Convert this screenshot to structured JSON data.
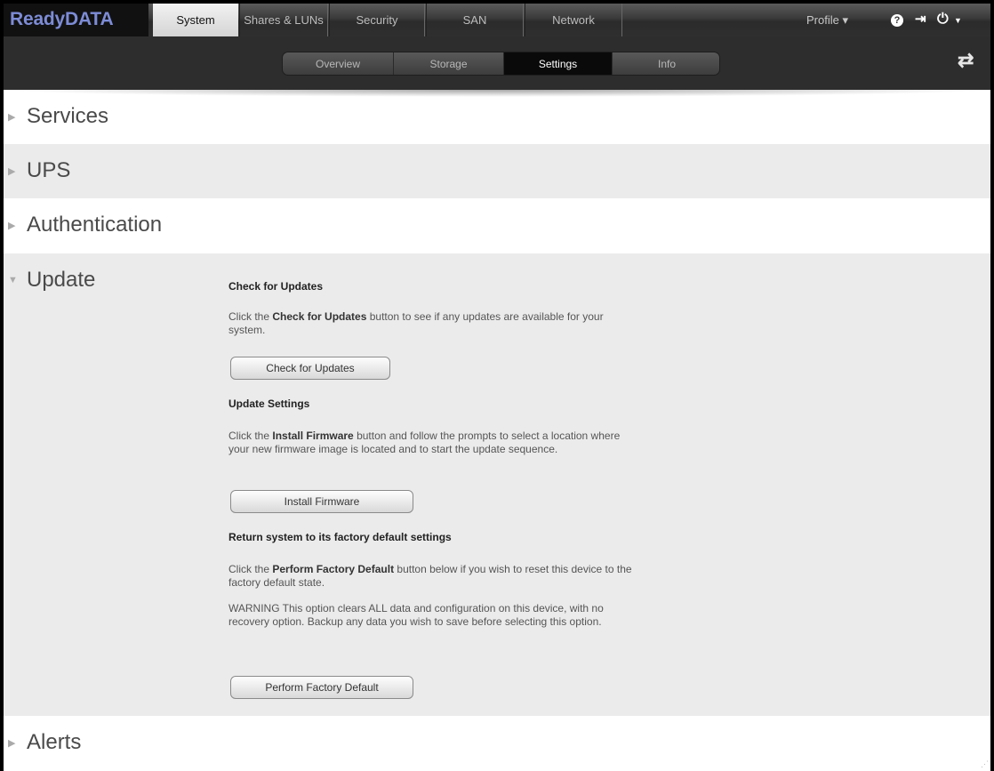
{
  "brand": "ReadyDATA",
  "top_tabs": [
    {
      "label": "System",
      "active": true
    },
    {
      "label": "Shares & LUNs",
      "active": false
    },
    {
      "label": "Security",
      "active": false
    },
    {
      "label": "SAN",
      "active": false
    },
    {
      "label": "Network",
      "active": false
    }
  ],
  "top_right": {
    "profile_label": "Profile ▾",
    "help_icon": "help-icon",
    "logout_icon": "logout-icon",
    "power_icon": "power-icon"
  },
  "sub_tabs": [
    {
      "label": "Overview",
      "active": false
    },
    {
      "label": "Storage",
      "active": false
    },
    {
      "label": "Settings",
      "active": true
    },
    {
      "label": "Info",
      "active": false
    }
  ],
  "refresh_icon": "refresh-icon",
  "sections": {
    "services": "Services",
    "ups": "UPS",
    "authentication": "Authentication",
    "update": "Update",
    "alerts": "Alerts"
  },
  "update": {
    "check_heading": "Check for Updates",
    "check_text_pre": "Click the ",
    "check_text_bold": "Check for Updates",
    "check_text_post": " button to see if any updates are available for your system.",
    "check_button": "Check for Updates",
    "settings_heading": "Update Settings",
    "settings_text_pre": "Click the ",
    "settings_text_bold": "Install Firmware",
    "settings_text_post": " button and follow the prompts to select a location where your new firmware image is located and to start the update sequence.",
    "install_button": "Install Firmware",
    "factory_heading": "Return system to its factory default settings",
    "factory_text_pre": "Click the ",
    "factory_text_bold": "Perform Factory Default",
    "factory_text_post": " button below if you wish to reset this device to the factory default state.",
    "warning_text": "WARNING This option clears ALL data and configuration on this device, with no recovery option. Backup any data you wish to save before selecting this option.",
    "factory_button": "Perform Factory Default"
  },
  "colors": {
    "brand": "#7d8cd6",
    "alt_row": "#ebebeb",
    "nav_dark": "#2d2d2d"
  }
}
